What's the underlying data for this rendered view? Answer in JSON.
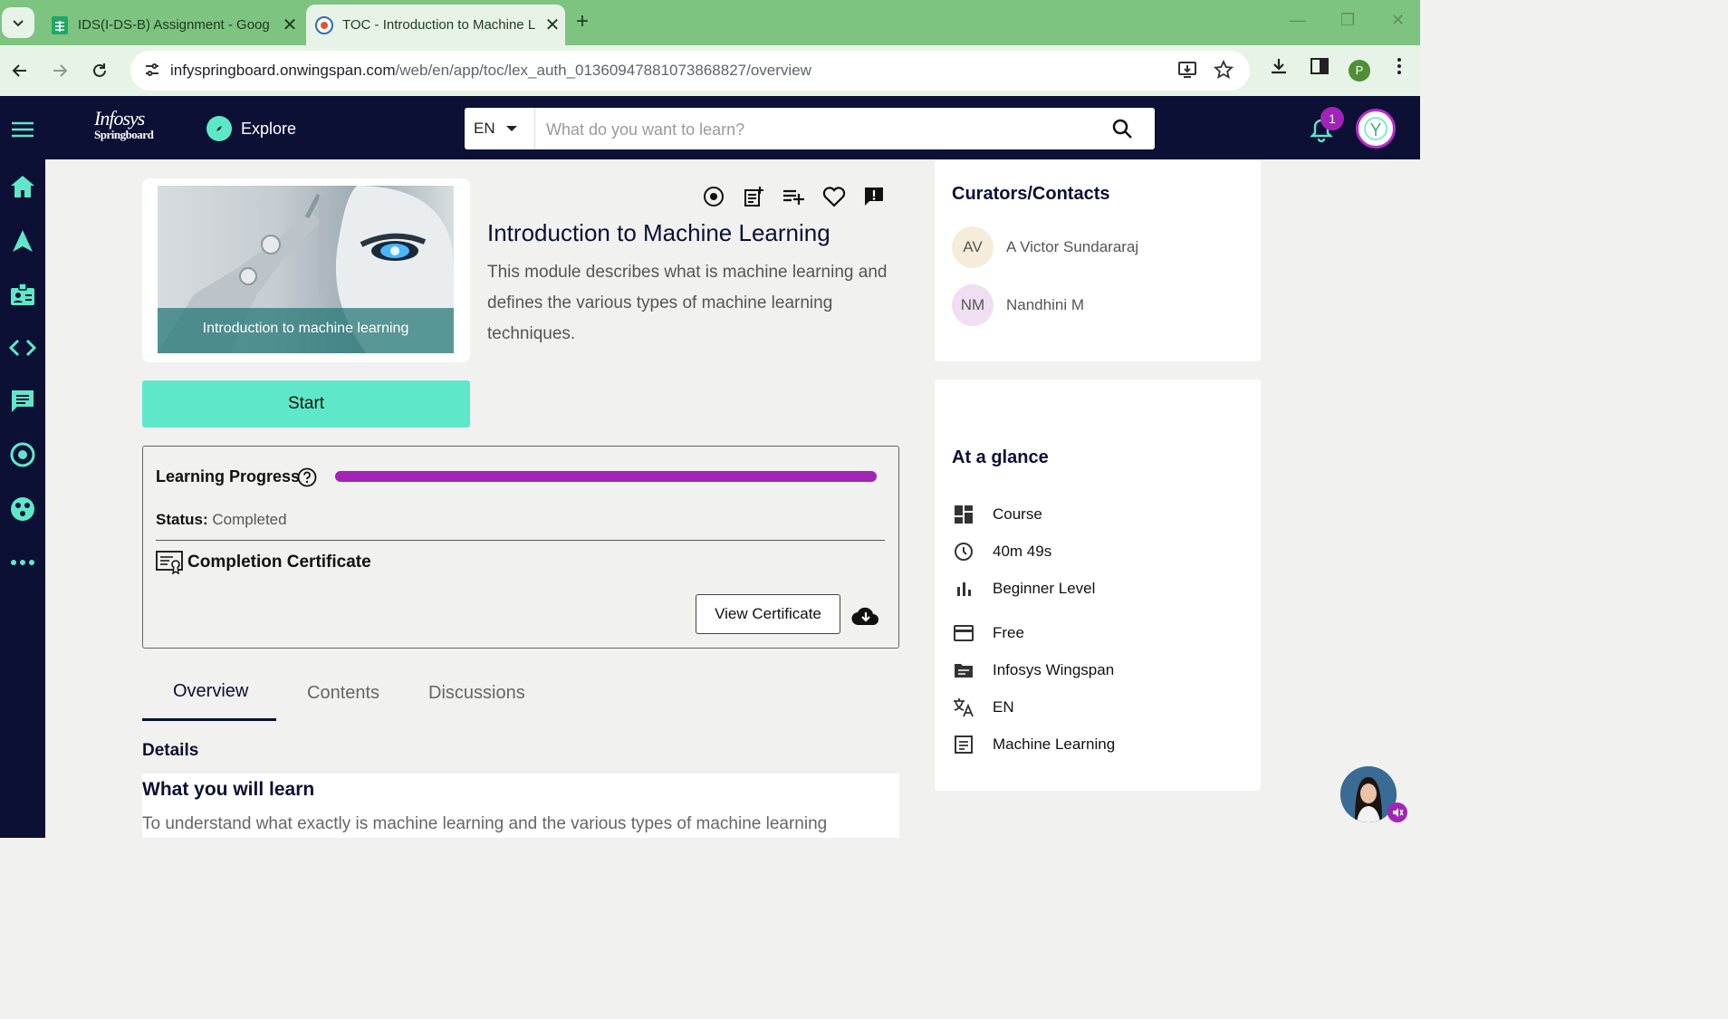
{
  "browser": {
    "tabs": [
      {
        "title": "IDS(I-DS-B) Assignment - Goog"
      },
      {
        "title": "TOC - Introduction to Machine L"
      }
    ],
    "url_host": "infyspringboard.onwingspan.com",
    "url_path": "/web/en/app/toc/lex_auth_01360947881073868827/overview",
    "profile_initial": "P"
  },
  "header": {
    "logo_line1": "Infosys",
    "logo_line2": "Springboard",
    "explore_label": "Explore",
    "language": "EN",
    "search_placeholder": "What do you want to learn?",
    "notification_count": "1"
  },
  "course": {
    "thumbnail_caption": "Introduction to machine learning",
    "title": "Introduction to Machine Learning",
    "description": "This module describes what is machine learning and defines the various types of machine learning techniques.",
    "start_label": "Start"
  },
  "progress": {
    "label": "Learning Progress",
    "percent": 100,
    "status_label": "Status:",
    "status_value": "Completed",
    "certificate_label": "Completion Certificate",
    "view_certificate_label": "View Certificate"
  },
  "tabs": [
    "Overview",
    "Contents",
    "Discussions"
  ],
  "details": {
    "heading": "Details",
    "learn_title": "What you will learn",
    "learn_text": "To understand what exactly is machine learning and the various types of machine learning"
  },
  "curators": {
    "heading": "Curators/Contacts",
    "contacts": [
      {
        "initials": "AV",
        "name": "A Victor Sundararaj",
        "color": "#f5ecd9"
      },
      {
        "initials": "NM",
        "name": "Nandhini M",
        "color": "#f0dff3"
      }
    ]
  },
  "glance": {
    "heading": "At a glance",
    "items": [
      {
        "icon": "dashboard-icon",
        "text": "Course"
      },
      {
        "icon": "clock-icon",
        "text": "40m 49s"
      },
      {
        "icon": "bar-chart-icon",
        "text": "Beginner Level"
      },
      {
        "icon": "credit-card-icon",
        "text": "Free"
      },
      {
        "icon": "folder-icon",
        "text": "Infosys Wingspan"
      },
      {
        "icon": "translate-icon",
        "text": "EN"
      },
      {
        "icon": "subject-icon",
        "text": "Machine Learning"
      }
    ]
  },
  "colors": {
    "nav_bg": "#0c1034",
    "accent_teal": "#5ee8c9",
    "progress_purple": "#a323b8",
    "browser_green": "#7cc47f"
  }
}
